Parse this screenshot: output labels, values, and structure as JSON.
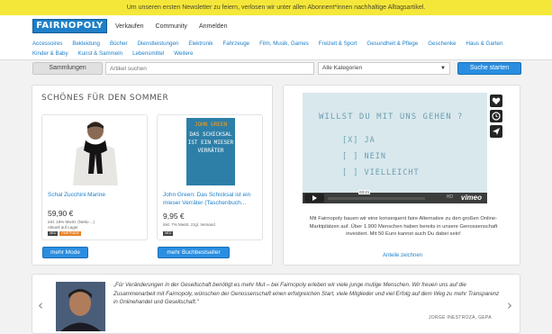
{
  "banner": {
    "text": "Um unseren ersten Newsletter zu feiern, verlosen wir unter allen Abonnent*innen nachhaltige Alltagsartikel."
  },
  "header": {
    "logo": "FAIRNOPOLY",
    "nav": [
      "Verkaufen",
      "Community",
      "Anmelden"
    ],
    "categories_row1": [
      "Accessoires",
      "Bekleidung",
      "Bücher",
      "Dienstleistungen",
      "Elektronik",
      "Fahrzeuge",
      "Film, Musik, Games",
      "Freizeit & Sport",
      "Gesundheit & Pflege",
      "Geschenke",
      "Haus & Garten"
    ],
    "categories_row2": [
      "Kinder & Baby",
      "Kunst & Sammeln",
      "Lebensmittel",
      "Weitere"
    ]
  },
  "search": {
    "collections_label": "Sammlungen",
    "placeholder": "Artikel suchen",
    "category_selected": "Alle Kategorien",
    "button_label": "Suche starten"
  },
  "featured": {
    "title": "SCHÖNES FÜR DEN SOMMER",
    "products": [
      {
        "title": "Schal Zucchini Marine",
        "price": "59,90 €",
        "vat": "inkl. 19% MwSt. (Netto ...)",
        "shipping": "Aktuell auf Lager",
        "tags": [
          "NEU",
          "FAIRTRADE"
        ],
        "button": "mehr Mode"
      },
      {
        "title": "John Green: Das Schicksal ist ein mieser Verräter (Taschenbuch...",
        "price": "9,95 €",
        "vat": "inkl. 7% MwSt. zzgl. Versand",
        "shipping": "",
        "tags": [
          "NEU"
        ],
        "button": "mehr Buchbestseller"
      }
    ]
  },
  "video": {
    "question": "WILLST DU MIT UNS GEHEN ?",
    "options": [
      "[X] JA",
      "[ ] NEIN",
      "[ ] VIELLEICHT"
    ],
    "timecode": "03:21",
    "hd": "HD",
    "provider": "vimeo",
    "description": "Mit Fairnopoly bauen wir eine konsequent faire Alternative zu den großen Online-Marktplätzen auf. Über 1.900 Menschen haben bereits in unsere Genossenschaft investiert. Mit 50 Euro kannst auch Du dabei sein!",
    "more_link": "Anteile zeichnen"
  },
  "testimonial": {
    "quote": "„Für Veränderungen in der Gesellschaft benötigt es mehr Mut – bei Fairnopoly erleben wir viele junge mutige Menschen. Wir freuen uns auf die Zusammenarbeit mit Fairnopoly, wünschen der Genossenschaft einen erfolgreichen Start, viele Mitglieder und viel Erfolg auf dem Weg zu mehr Transparenz in Onlinehandel und Gesellschaft.\"",
    "author": "JORGE INESTROZA, GEPA"
  },
  "colors": {
    "accent": "#2a8ee0",
    "banner": "#f5e73a",
    "link": "#1e7fc8"
  }
}
